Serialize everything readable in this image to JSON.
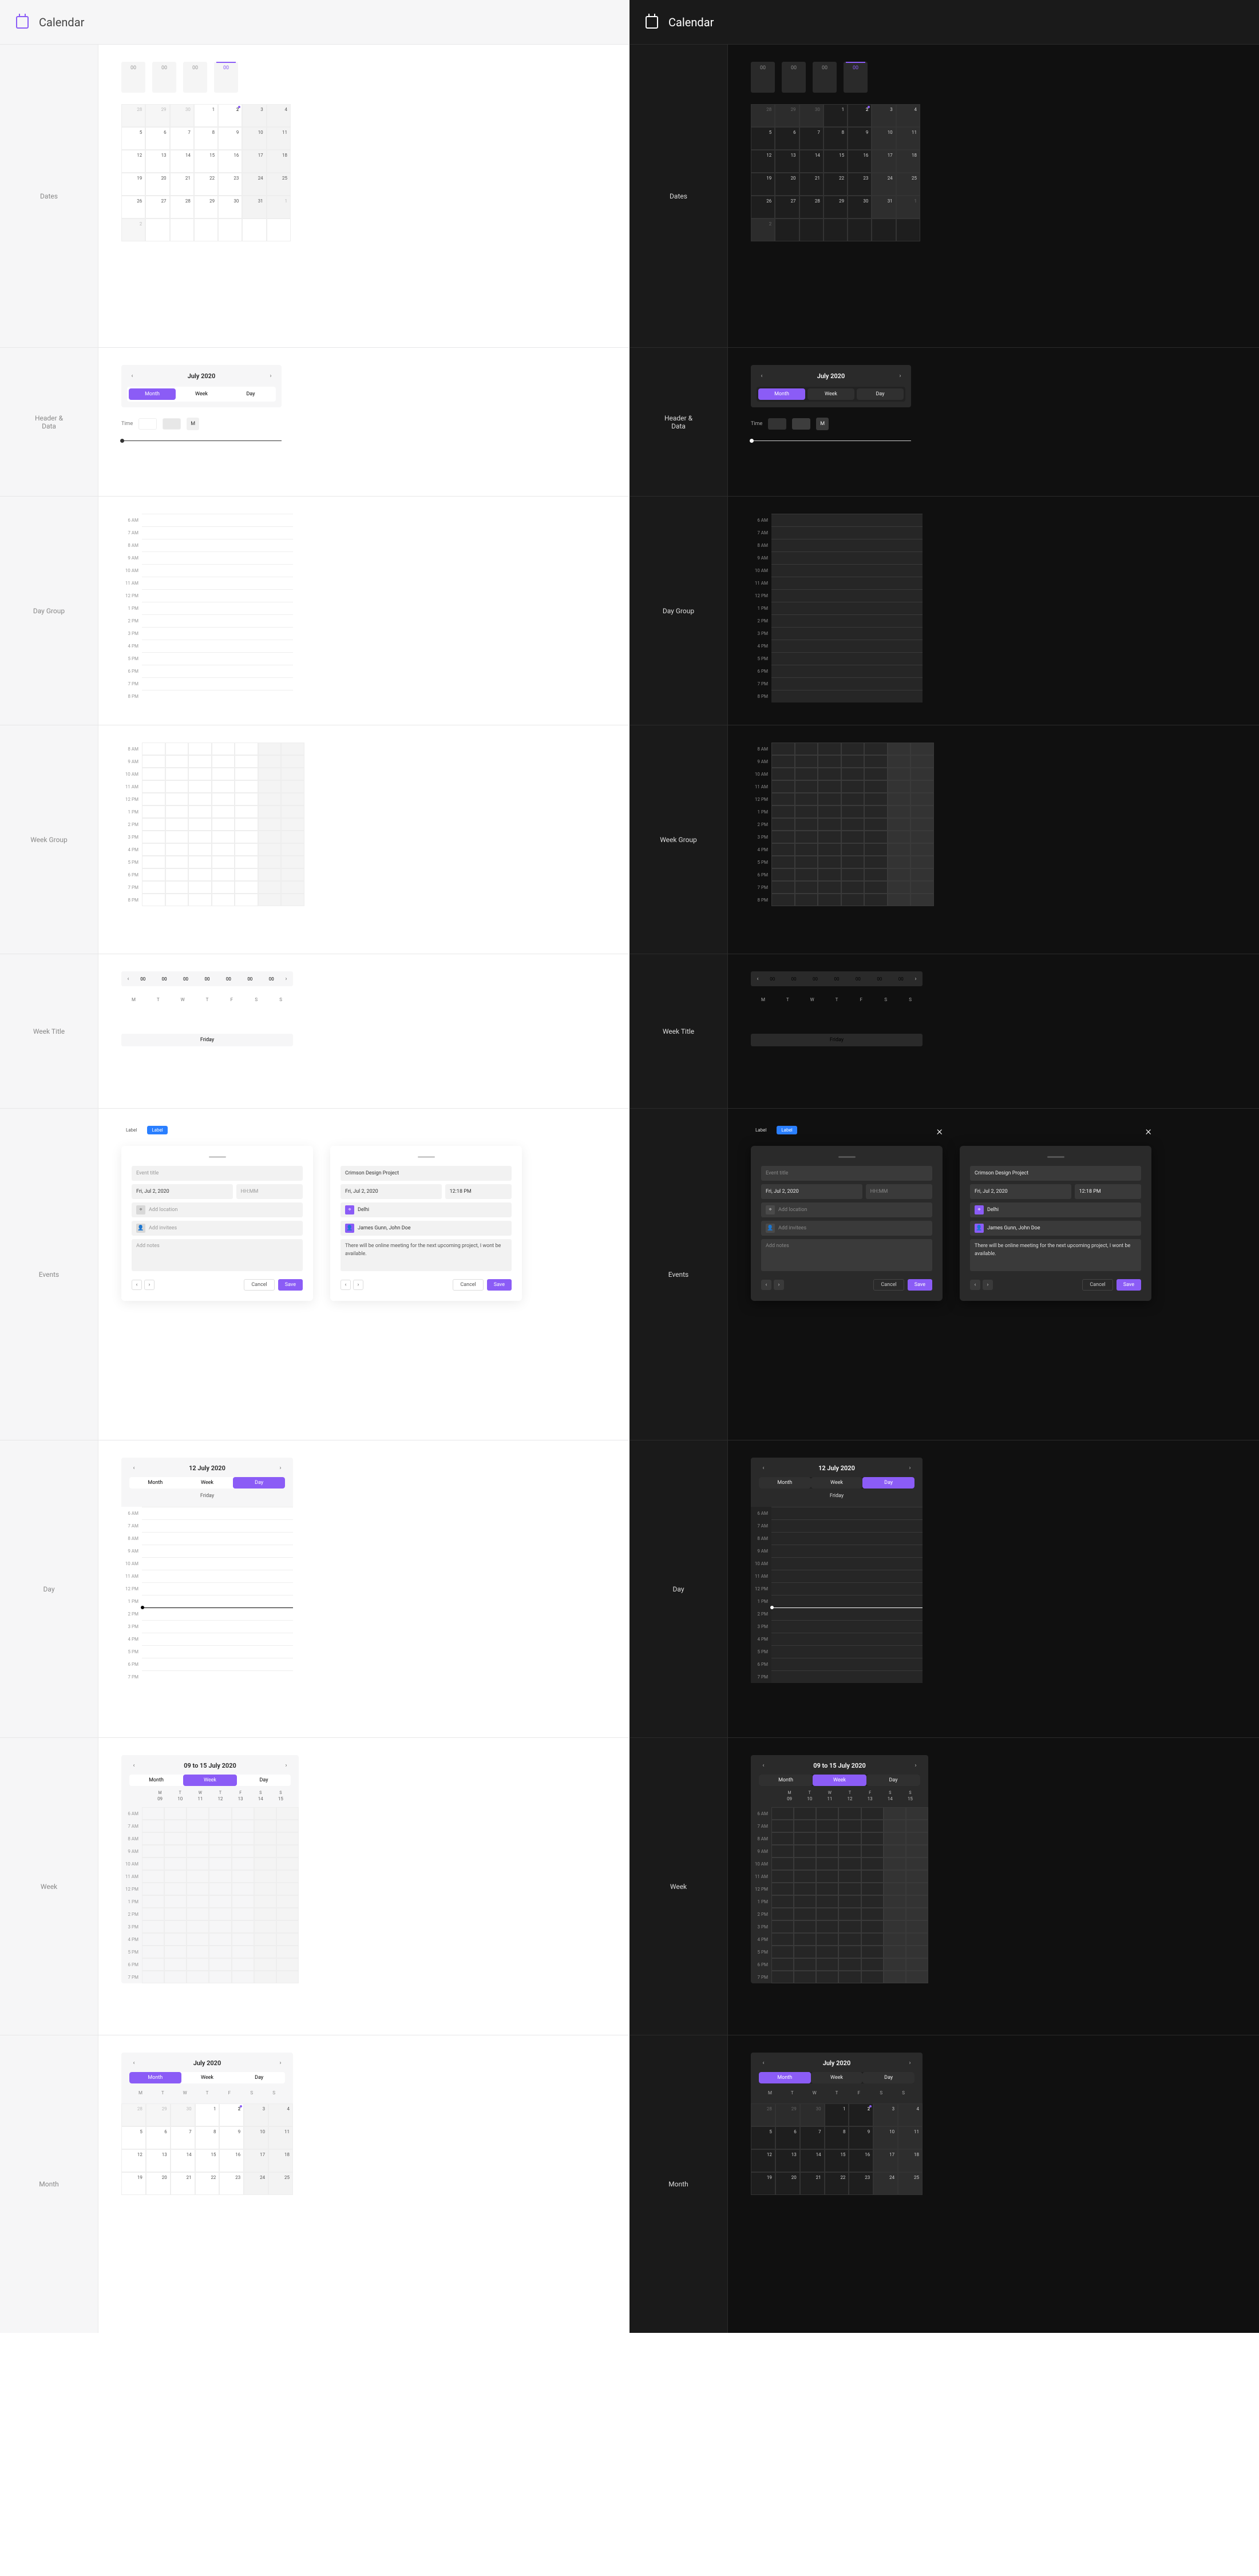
{
  "app": {
    "title": "Calendar"
  },
  "sections": {
    "dates": "Dates",
    "header_data": "Header &\nData",
    "day_group": "Day Group",
    "week_group": "Week Group",
    "week_title": "Week Title",
    "events": "Events",
    "day": "Day",
    "week": "Week",
    "month": "Month"
  },
  "date_cells": [
    "00",
    "00",
    "00",
    "00"
  ],
  "month_grid": {
    "prev_tail": [
      28,
      29,
      30
    ],
    "days": 31,
    "today": 2,
    "next_head": [
      1,
      2
    ]
  },
  "nav": {
    "title": "July 2020",
    "tabs": [
      "Month",
      "Week",
      "Day"
    ],
    "active_tab": 0,
    "time_label": "Time",
    "sq_label": "M"
  },
  "day_hours": [
    "6 AM",
    "7 AM",
    "8 AM",
    "9 AM",
    "10 AM",
    "11 AM",
    "12 PM",
    "1 PM",
    "2 PM",
    "3 PM",
    "4 PM",
    "5 PM",
    "6 PM",
    "7 PM",
    "8 PM"
  ],
  "week_hours": [
    "8 AM",
    "9 AM",
    "10 AM",
    "11 AM",
    "12 PM",
    "1 PM",
    "2 PM",
    "3 PM",
    "4 PM",
    "5 PM",
    "6 PM",
    "7 PM",
    "8 PM"
  ],
  "week_title": {
    "slots": [
      "00",
      "00",
      "00",
      "00",
      "00",
      "00",
      "00"
    ],
    "days": [
      "M",
      "T",
      "W",
      "T",
      "F",
      "S",
      "S"
    ],
    "banner": "Friday"
  },
  "pager": {
    "prev": "‹",
    "next": "›"
  },
  "events": {
    "chip_label": "Label",
    "chip_primary": "Label",
    "close": "×",
    "form": {
      "title_ph": "Event title",
      "date_ph": "Fri, Jul 2, 2020",
      "time_ph": "HH:MM",
      "location_ph": "Add location",
      "invitees_ph": "Add invitees",
      "notes_ph": "Add notes",
      "cancel": "Cancel",
      "save": "Save"
    },
    "populated": {
      "title": "Crimson Design Project",
      "date": "Fri, Jul 2, 2020",
      "time": "12:18 PM",
      "location": "Delhi",
      "invitees": "James Gunn, John Doe",
      "notes": "There will be online meeting for the next upcoming project, I wont be available."
    }
  },
  "day_view": {
    "title": "12 July 2020",
    "tabs": [
      "Month",
      "Week",
      "Day"
    ],
    "active_tab": 2,
    "dayname": "Friday",
    "hours": [
      "6 AM",
      "7 AM",
      "8 AM",
      "9 AM",
      "10 AM",
      "11 AM",
      "12 PM",
      "1 PM",
      "2 PM",
      "3 PM",
      "4 PM",
      "5 PM",
      "6 PM",
      "7 PM"
    ],
    "now_after": "1 PM"
  },
  "week_view": {
    "title": "09 to 15 July 2020",
    "tabs": [
      "Month",
      "Week",
      "Day"
    ],
    "active_tab": 1,
    "dow": [
      "M",
      "T",
      "W",
      "T",
      "F",
      "S",
      "S"
    ],
    "nums": [
      "09",
      "10",
      "11",
      "12",
      "13",
      "14",
      "15"
    ],
    "hours": [
      "6 AM",
      "7 AM",
      "8 AM",
      "9 AM",
      "10 AM",
      "11 AM",
      "12 PM",
      "1 PM",
      "2 PM",
      "3 PM",
      "4 PM",
      "5 PM",
      "6 PM",
      "7 PM"
    ]
  },
  "month_view": {
    "title": "July 2020",
    "tabs": [
      "Month",
      "Week",
      "Day"
    ],
    "active_tab": 0,
    "dow": [
      "M",
      "T",
      "W",
      "T",
      "F",
      "S",
      "S"
    ],
    "prev_tail": [
      28,
      29,
      30
    ],
    "days": 25,
    "today": 2
  }
}
